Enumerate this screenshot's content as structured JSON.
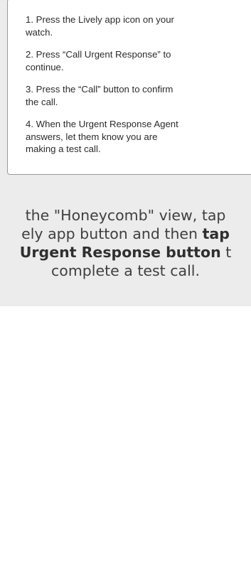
{
  "card": {
    "steps": [
      "1. Press the Lively app icon on your\nwatch.",
      "2. Press “Call Urgent Response” to\ncontinue.",
      "3. Press the “Call” button to confirm\nthe call.",
      "4. When the Urgent Response Agent\nanswers, let them know you are\nmaking a test call."
    ]
  },
  "caption": {
    "line1": "the \"Honeycomb\" view, tap",
    "line2_a": "ely app button and then ",
    "line2_b": "tap",
    "line3_a": "Urgent Response button",
    "line3_b": " t",
    "line4": "complete a test call."
  },
  "colors": {
    "panel_bg": "#ececec",
    "card_bg": "#ffffff",
    "card_border": "#9a9a9a",
    "text": "#3f3f3f"
  }
}
